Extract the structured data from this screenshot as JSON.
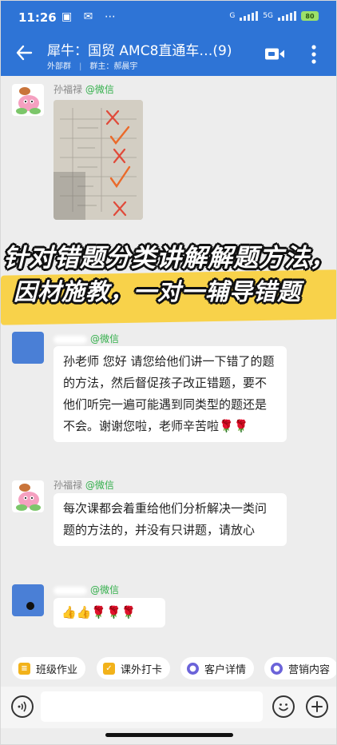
{
  "status_bar": {
    "time": "11:26",
    "icons": "▣ ✉ ⋯",
    "network_1": "G",
    "network_2": "5G",
    "battery": "80"
  },
  "header": {
    "title": "犀牛：国贸 AMC8直通车…(9)",
    "group_type": "外部群",
    "owner": "群主：郝晨宇",
    "color": "#2e74d6"
  },
  "messages": [
    {
      "sender": "孙福禄",
      "platform": "@微信",
      "type": "image"
    },
    {
      "sender": "",
      "platform": "@微信",
      "type": "text",
      "text": "孙老师 您好 请您给他们讲一下错了的题的方法，然后督促孩子改正错题，要不他们听完一遍可能遇到同类型的题还是不会。谢谢您啦，老师辛苦啦🌹🌹"
    },
    {
      "sender": "孙福禄",
      "platform": "@微信",
      "type": "text",
      "text": "每次课都会着重给他们分析解决一类问题的方法的，并没有只讲题，请放心"
    },
    {
      "sender": "",
      "platform": "@微信",
      "type": "text",
      "text": "👍👍🌹🌹🌹"
    }
  ],
  "promo": {
    "line1": "针对错题分类讲解解题方法，",
    "line2": "因材施教，一对一辅导错题",
    "band_color": "#f8d24a"
  },
  "quick_actions": [
    {
      "label": "班级作业",
      "icon": "homework-icon"
    },
    {
      "label": "课外打卡",
      "icon": "checkin-icon"
    },
    {
      "label": "客户详情",
      "icon": "customer-icon"
    },
    {
      "label": "营销内容",
      "icon": "marketing-icon"
    }
  ],
  "input_bar": {
    "placeholder": ""
  },
  "colors": {
    "wechat_green": "#34b04c",
    "mark_red": "#e04a3a",
    "mark_orange": "#ea6a2a"
  }
}
